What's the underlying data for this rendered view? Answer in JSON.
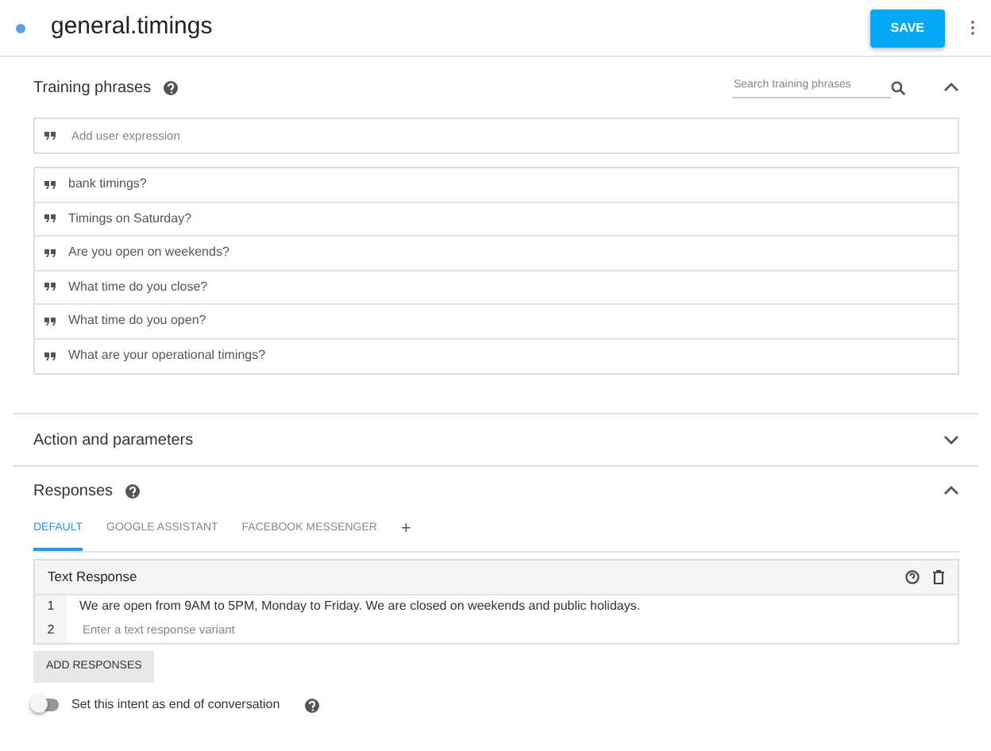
{
  "header": {
    "title": "general.timings",
    "save": "SAVE"
  },
  "training": {
    "title": "Training phrases",
    "expanded": true,
    "search": {
      "placeholder": "Search training phrases"
    },
    "add": {
      "placeholder": "Add user expression"
    },
    "phrases": [
      "bank timings?",
      "Timings on Saturday?",
      "Are you open on weekends?",
      "What time do you close?",
      "What time do you open?",
      "What are your operational timings?"
    ]
  },
  "action": {
    "title": "Action and parameters",
    "expanded": false
  },
  "responses": {
    "title": "Responses",
    "expanded": true,
    "tabs": [
      {
        "label": "DEFAULT",
        "selected": true
      },
      {
        "label": "GOOGLE ASSISTANT",
        "selected": false
      },
      {
        "label": "FACEBOOK MESSENGER",
        "selected": false
      }
    ],
    "add_tab": "+",
    "card": {
      "title": "Text Response",
      "rows": [
        {
          "number": "1",
          "text": "We are open from 9AM to 5PM, Monday to Friday. We are closed on weekends and public holidays."
        },
        {
          "number": "2",
          "placeholder": "Enter a text response variant"
        }
      ]
    },
    "add_button": "ADD RESPONSES",
    "end_toggle": {
      "label": "Set this intent as end of conversation",
      "on": false
    }
  }
}
